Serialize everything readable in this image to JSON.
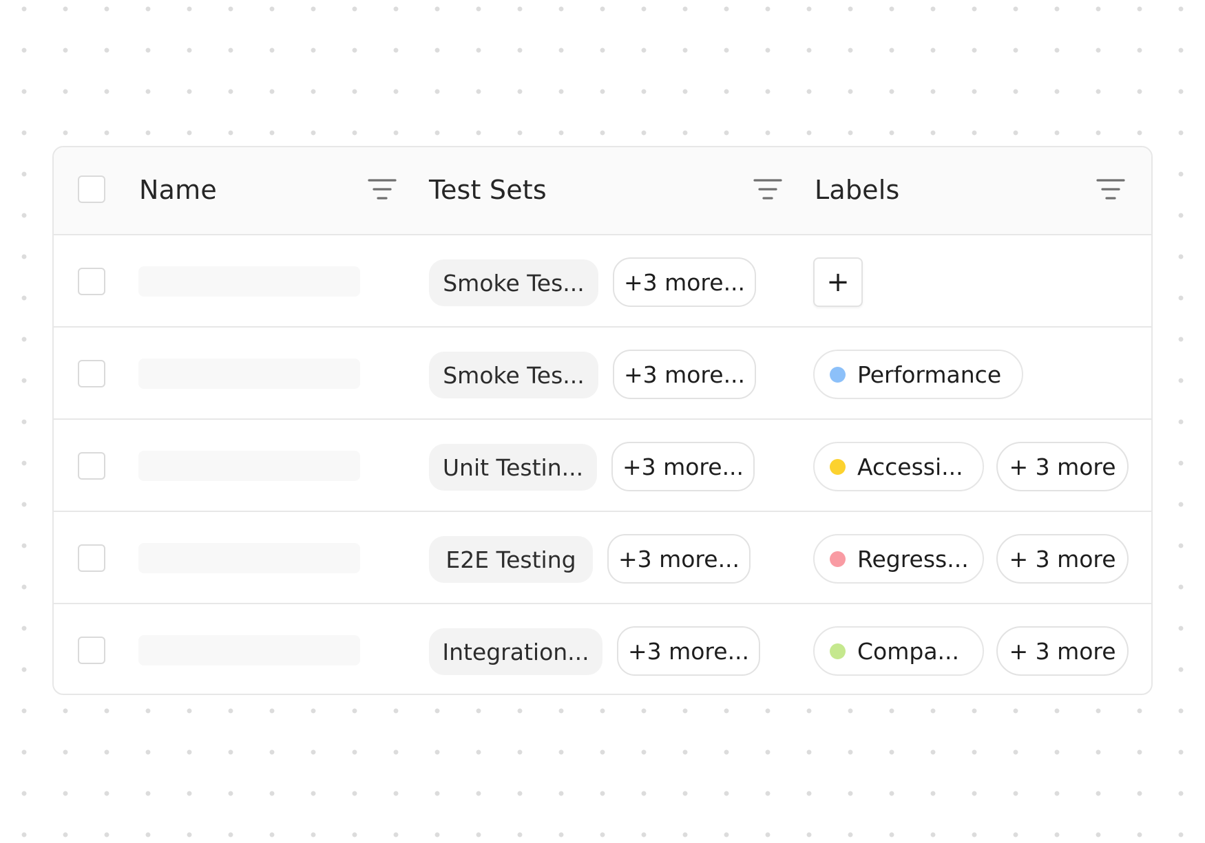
{
  "columns": {
    "name": "Name",
    "test_sets": "Test Sets",
    "labels": "Labels"
  },
  "icons": {
    "filter": "filter-lines-icon",
    "checkbox": "checkbox-unchecked"
  },
  "rows": [
    {
      "test_set": "Smoke Tes...",
      "test_set_more": "+3 more...",
      "label": null,
      "add_label": "+"
    },
    {
      "test_set": "Smoke Tes...",
      "test_set_more": "+3 more...",
      "label": {
        "text": "Performance",
        "color": "#8cc0f9"
      }
    },
    {
      "test_set": "Unit Testin...",
      "test_set_more": "+3 more...",
      "label": {
        "text": "Accessi...",
        "color": "#fcd22f"
      },
      "label_more": "+ 3 more"
    },
    {
      "test_set": "E2E Testing",
      "test_set_more": "+3 more...",
      "label": {
        "text": "Regress...",
        "color": "#f99ba3"
      },
      "label_more": "+ 3 more"
    },
    {
      "test_set": "Integration...",
      "test_set_more": "+3 more...",
      "label": {
        "text": "Compa...",
        "color": "#c5e88e"
      },
      "label_more": "+ 3 more"
    }
  ]
}
